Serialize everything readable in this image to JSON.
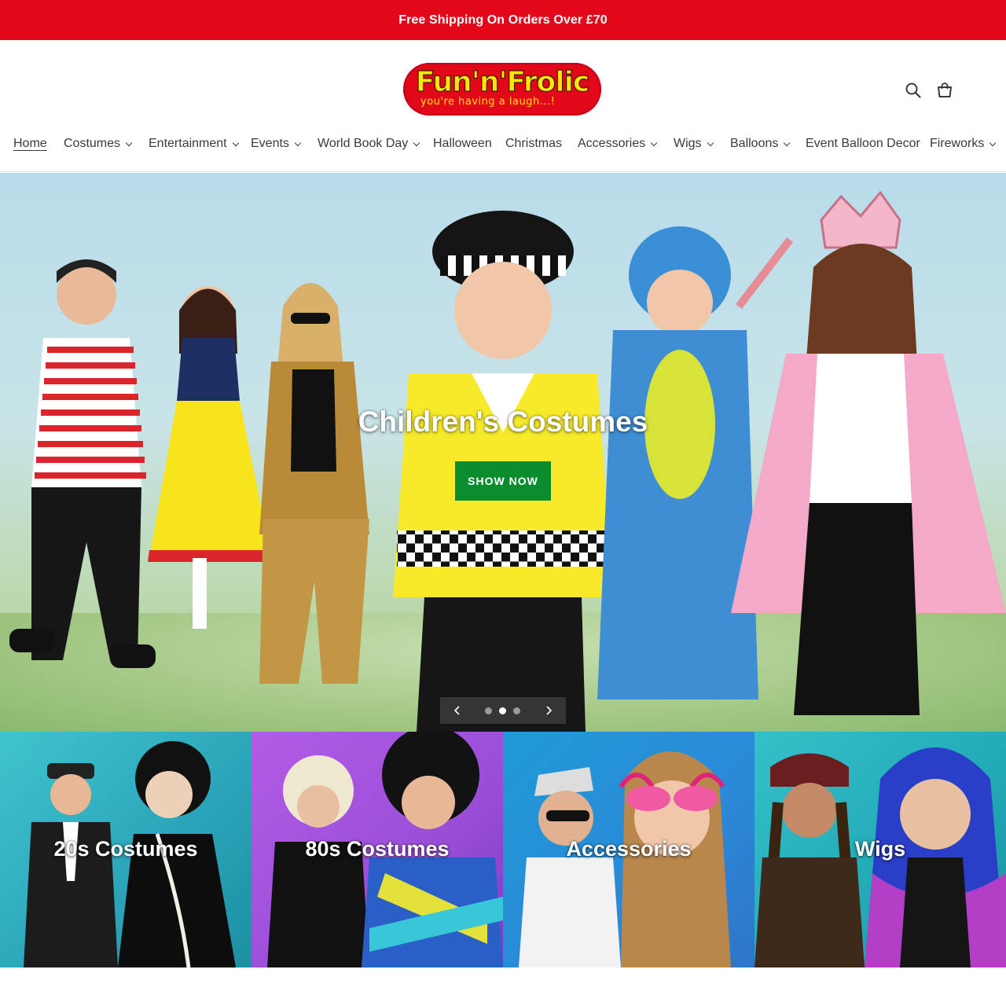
{
  "announcement": {
    "text": "Free Shipping On Orders Over £70"
  },
  "brand": {
    "logo_text": "Fun'n'Frolic",
    "tagline": "you're having a laugh...!",
    "color": "#e3071a",
    "logo_yellow": "#ffe600"
  },
  "header": {
    "search_icon": "search-icon",
    "cart_icon": "cart-icon"
  },
  "nav": {
    "items": [
      {
        "label": "Home",
        "dropdown": false,
        "active": true
      },
      {
        "label": "Costumes",
        "dropdown": true
      },
      {
        "label": "Entertainment",
        "dropdown": true
      },
      {
        "label": "Events",
        "dropdown": true
      },
      {
        "label": "World Book Day",
        "dropdown": true
      },
      {
        "label": "Halloween",
        "dropdown": false
      },
      {
        "label": "Christmas",
        "dropdown": false
      },
      {
        "label": "Accessories",
        "dropdown": true
      },
      {
        "label": "Wigs",
        "dropdown": true
      },
      {
        "label": "Balloons",
        "dropdown": true
      },
      {
        "label": "Event Balloon Decor",
        "dropdown": false
      },
      {
        "label": "Fireworks",
        "dropdown": true
      }
    ]
  },
  "hero": {
    "title": "Children's Costumes",
    "button_label": "SHOW NOW",
    "button_color": "#0b8c2f",
    "slides_total": 3,
    "active_slide": 2
  },
  "collections": [
    {
      "label": "20s Costumes"
    },
    {
      "label": "80s Costumes"
    },
    {
      "label": "Accessories"
    },
    {
      "label": "Wigs"
    }
  ]
}
